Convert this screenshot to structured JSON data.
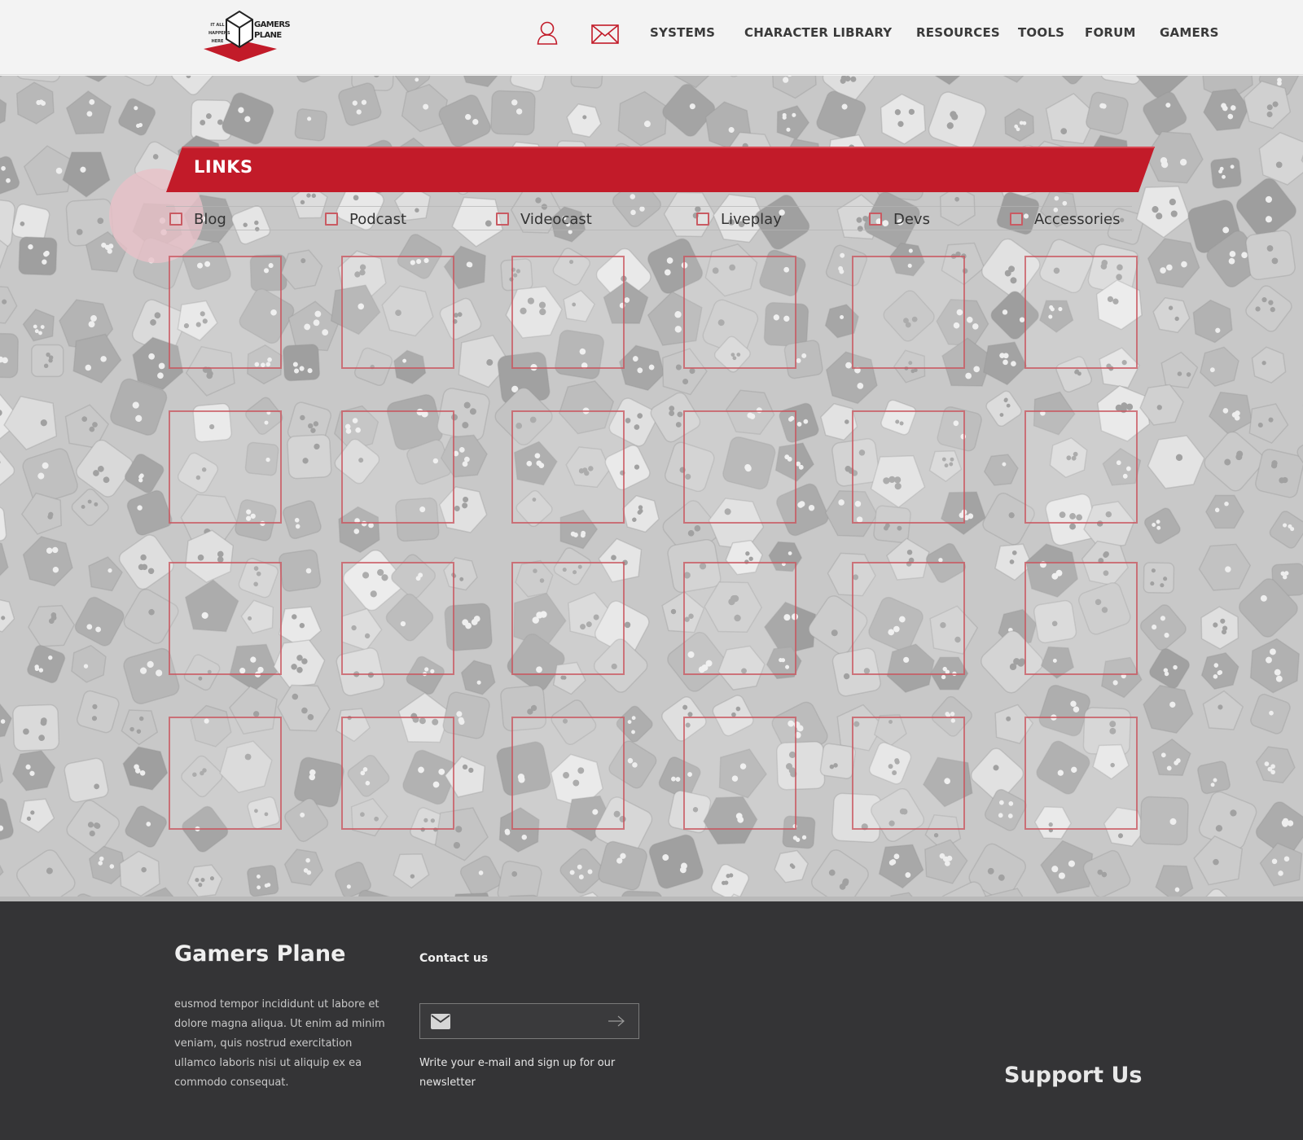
{
  "header": {
    "logo": {
      "tagline": "IT ALL HAPPENS HERE",
      "wordmark_line1": "GAMERS",
      "wordmark_line2": "PLANE"
    },
    "icons": {
      "user": "user-icon",
      "mail": "mail-icon"
    },
    "nav": [
      "SYSTEMS",
      "CHARACTER LIBRARY",
      "RESOURCES",
      "TOOLS",
      "FORUM",
      "GAMERS"
    ]
  },
  "links": {
    "title": "LINKS",
    "filters": [
      "Blog",
      "Podcast",
      "Videocast",
      "Liveplay",
      "Devs",
      "Accessories"
    ],
    "grid": {
      "rows": 4,
      "columns": 6
    }
  },
  "footer": {
    "brand": "Gamers Plane",
    "description": "eusmod tempor incididunt ut labore et dolore magna aliqua. Ut enim ad minim veniam, quis nostrud exercitation ullamco laboris nisi ut aliquip ex ea commodo consequat.",
    "contact_title": "Contact us",
    "email_value": "",
    "newsletter_note": "Write your e-mail and sign up for our newsletter",
    "support": "Support Us"
  },
  "colors": {
    "brand_red": "#c21b29",
    "footer_bg": "#343436",
    "header_bg": "#f3f3f3"
  }
}
